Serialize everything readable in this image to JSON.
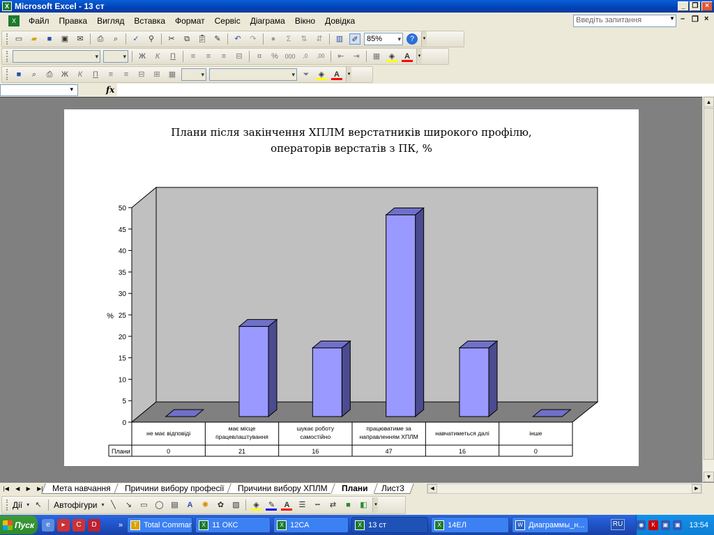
{
  "window": {
    "title": "Microsoft Excel - 13 ст",
    "app_icon": "X"
  },
  "menu": {
    "items": [
      "Файл",
      "Правка",
      "Вигляд",
      "Вставка",
      "Формат",
      "Сервіс",
      "Діаграма",
      "Вікно",
      "Довідка"
    ],
    "ask_placeholder": "Введіть запитання"
  },
  "toolbar": {
    "zoom": "85%"
  },
  "formula_bar": {
    "fx": "fx"
  },
  "chart_data": {
    "type": "bar",
    "title": [
      "Плани після закінчення ХПЛМ верстатників широкого профілю,",
      "операторів верстатів з ПК, %"
    ],
    "ylabel": "%",
    "ylim": [
      0,
      50
    ],
    "yticks": [
      0,
      5,
      10,
      15,
      20,
      25,
      30,
      35,
      40,
      45,
      50
    ],
    "categories": [
      [
        "не має відповіді"
      ],
      [
        "має місце",
        "працевлаштування"
      ],
      [
        "шукає роботу",
        "самостійно"
      ],
      [
        "працюватиме за",
        "направленням ХПЛМ"
      ],
      [
        "навчатиметься далі"
      ],
      [
        "інше"
      ]
    ],
    "series": [
      {
        "name": "Плани",
        "values": [
          0,
          21,
          16,
          47,
          16,
          0
        ],
        "color": "#9999ff"
      }
    ],
    "data_table": true,
    "grid": false
  },
  "sheet_tabs": [
    "Мета навчання",
    "Причини вибору професії",
    "Причини вибору ХПЛМ",
    "Плани",
    "Лист3"
  ],
  "active_tab": "Плани",
  "drawing_toolbar": {
    "actions": "Дії",
    "autoshapes": "Автофігури"
  },
  "taskbar": {
    "start": "Пуск",
    "tasks": [
      "Total Comman...",
      "11 ОКС",
      "12СА",
      "13 ст",
      "14ЕЛ",
      "Диаграммы_н..."
    ],
    "active_task": "13 ст",
    "lang": "RU",
    "clock": "13:54"
  }
}
